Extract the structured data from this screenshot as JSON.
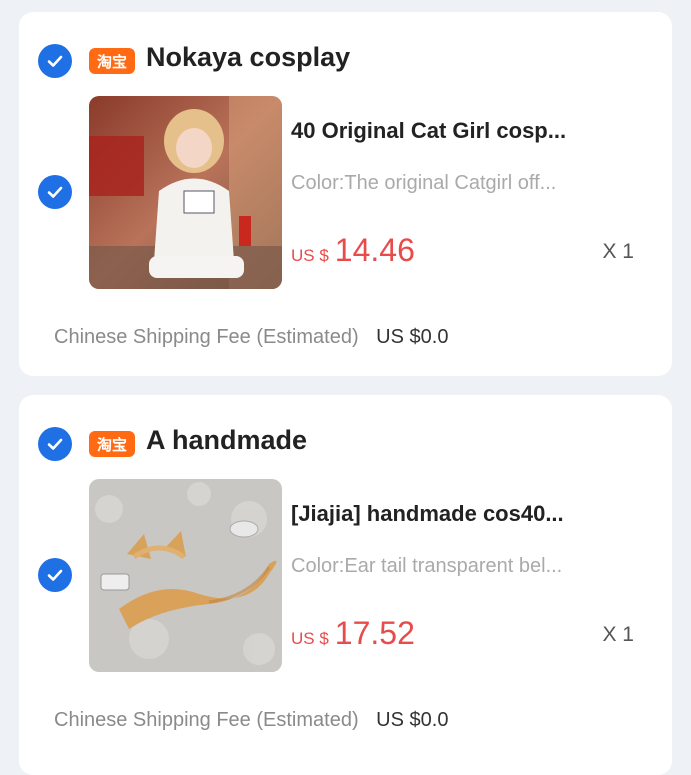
{
  "colors": {
    "accent": "#1f6fe5",
    "taobao_badge": "#ff6a13",
    "price": "#e84b4b",
    "background": "#eef1f5"
  },
  "stores": [
    {
      "badge_text": "淘宝",
      "name": "Nokaya cosplay",
      "selected": true,
      "item": {
        "selected": true,
        "title": "40 Original Cat Girl cosp...",
        "variant": "Color:The original Catgirl off...",
        "currency": "US $",
        "price": "14.46",
        "quantity": "X 1",
        "image_icon": "cosplay-photo"
      },
      "shipping": {
        "label": "Chinese Shipping Fee (Estimated)",
        "amount": "US $0.0"
      }
    },
    {
      "badge_text": "淘宝",
      "name": "A handmade",
      "selected": true,
      "item": {
        "selected": true,
        "title": "[Jiajia] handmade cos40...",
        "variant": "Color:Ear tail transparent bel...",
        "currency": "US $",
        "price": "17.52",
        "quantity": "X 1",
        "image_icon": "ears-and-tail-photo"
      },
      "shipping": {
        "label": "Chinese Shipping Fee (Estimated)",
        "amount": "US $0.0"
      }
    }
  ]
}
